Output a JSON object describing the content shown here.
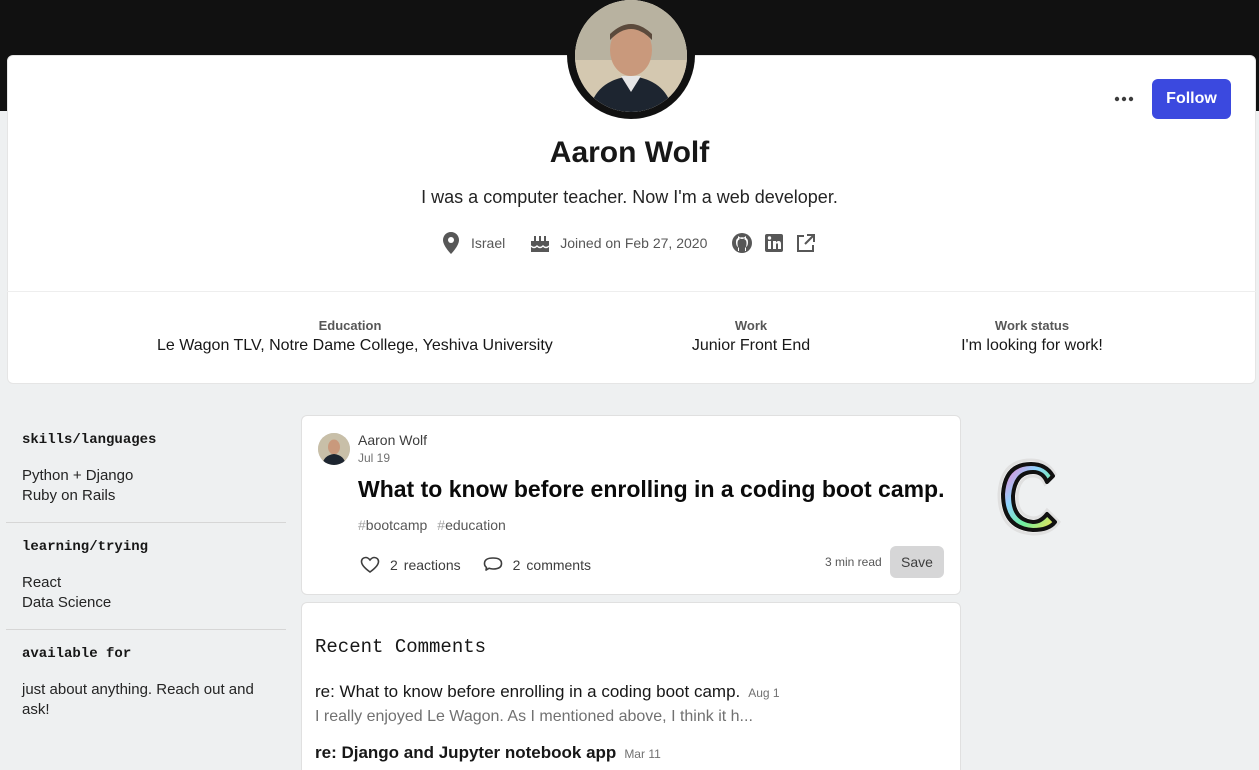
{
  "profile": {
    "name": "Aaron Wolf",
    "bio": "I was a computer teacher. Now I'm a web developer.",
    "location": "Israel",
    "joined": "Joined on Feb 27, 2020",
    "follow_label": "Follow"
  },
  "info": {
    "education_label": "Education",
    "education_value": "Le Wagon TLV, Notre Dame College, Yeshiva University",
    "work_label": "Work",
    "work_value": "Junior Front End",
    "status_label": "Work status",
    "status_value": "I'm looking for work!"
  },
  "sidebar": {
    "sections": [
      {
        "title": "skills/languages",
        "lines": [
          "Python + Django",
          "Ruby on Rails"
        ]
      },
      {
        "title": "learning/trying",
        "lines": [
          "React",
          "Data Science"
        ]
      },
      {
        "title": "available for",
        "lines": [
          "just about anything. Reach out and ask!"
        ]
      }
    ]
  },
  "post": {
    "author": "Aaron Wolf",
    "date": "Jul 19",
    "title": "What to know before enrolling in a coding boot camp.",
    "tags": [
      "bootcamp",
      "education"
    ],
    "reactions_count": "2",
    "reactions_label": "reactions",
    "comments_count": "2",
    "comments_label": "comments",
    "read_time": "3 min read",
    "save_label": "Save"
  },
  "comments": {
    "title": "Recent Comments",
    "items": [
      {
        "text": "re: What to know before enrolling in a coding boot camp.",
        "date": "Aug 1",
        "snippet": "I really enjoyed Le Wagon. As I mentioned above, I think it h..."
      },
      {
        "text": "re: Django and Jupyter notebook app",
        "date": "Mar 11"
      }
    ]
  },
  "colors": {
    "accent": "#3b49df",
    "header_band": "#111111",
    "background": "#eef0f1"
  },
  "icons": {
    "more": "more-horizontal-icon",
    "location": "location-pin-icon",
    "joined": "cake-icon",
    "github": "github-icon",
    "linkedin": "linkedin-icon",
    "external": "external-link-icon",
    "heart": "heart-icon",
    "comment": "comment-icon"
  }
}
